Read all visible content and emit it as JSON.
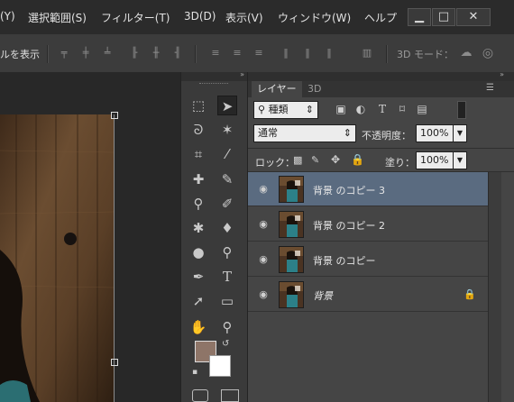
{
  "menu": {
    "items": [
      {
        "label": "(Y)"
      },
      {
        "label": "選択範囲(S)"
      },
      {
        "label": "フィルター(T)"
      },
      {
        "label": "3D(D)"
      },
      {
        "label": "表示(V)"
      },
      {
        "label": "ウィンドウ(W)"
      },
      {
        "label": "ヘルプ"
      }
    ],
    "window_controls": {
      "minimize": "▁",
      "maximize": "□",
      "close": "✕"
    }
  },
  "options_bar": {
    "show_transform_label": "ルを表示",
    "mode_label": "3D モード："
  },
  "layers_panel": {
    "tabs": [
      {
        "label": "レイヤー"
      },
      {
        "label": "3D"
      }
    ],
    "filter": {
      "kind_label": "種類",
      "kind_icon": "search-icon"
    },
    "blend_mode": "通常",
    "opacity_label": "不透明度：",
    "opacity_value": "100%",
    "lock_label": "ロック：",
    "fill_label": "塗り：",
    "fill_value": "100%",
    "layers": [
      {
        "name": "背景 のコピー 3",
        "selected": true,
        "locked": false
      },
      {
        "name": "背景 のコピー 2",
        "selected": false,
        "locked": false
      },
      {
        "name": "背景 のコピー",
        "selected": false,
        "locked": false
      },
      {
        "name": "背景",
        "selected": false,
        "locked": true
      }
    ]
  },
  "toolbox": {
    "foreground_color": "#8e7568",
    "background_color": "#ffffff"
  },
  "colors": {
    "selected_layer": "#5a6b80",
    "panel_bg": "#454545",
    "menubar_bg": "#2b2b2b"
  }
}
